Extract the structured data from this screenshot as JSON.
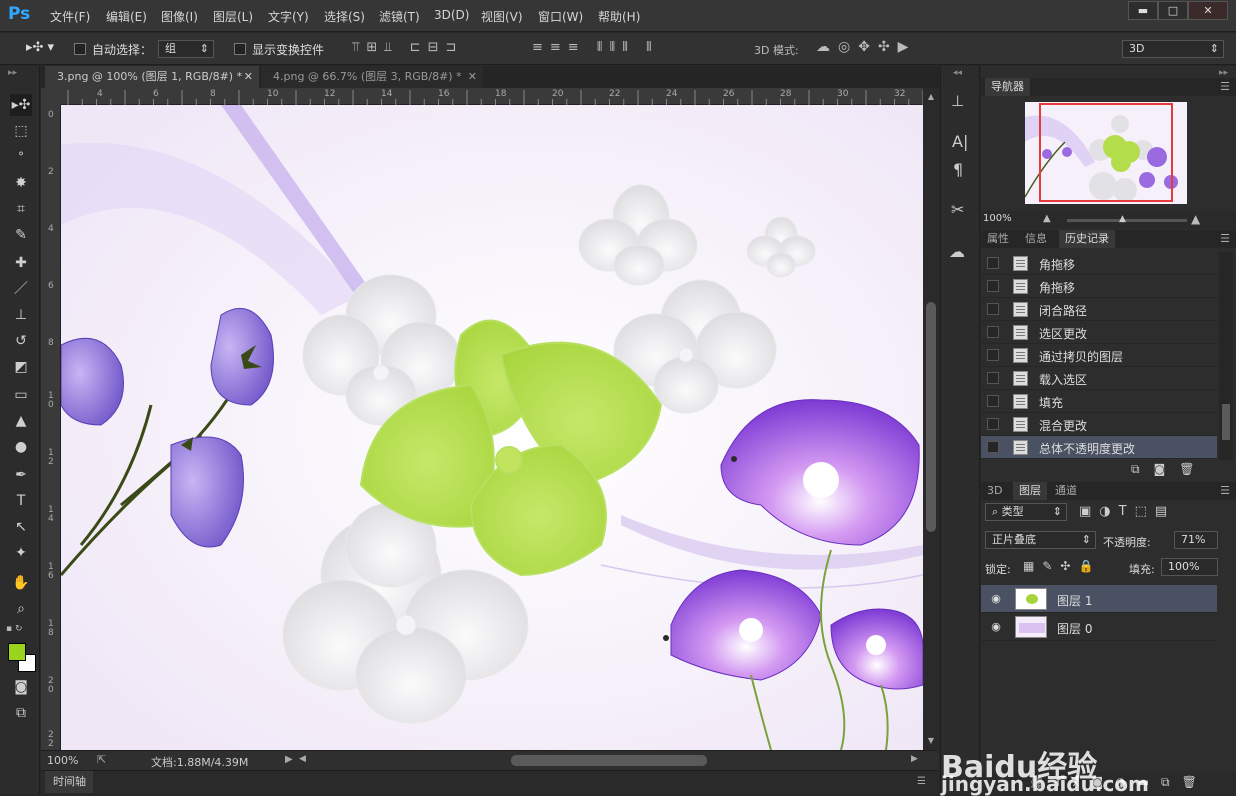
{
  "app": {
    "logo": "Ps"
  },
  "menu": [
    "文件(F)",
    "编辑(E)",
    "图像(I)",
    "图层(L)",
    "文字(Y)",
    "选择(S)",
    "滤镜(T)",
    "3D(D)",
    "视图(V)",
    "窗口(W)",
    "帮助(H)"
  ],
  "window_buttons": [
    "▬",
    "□",
    "✕"
  ],
  "options": {
    "auto_select_label": "自动选择：",
    "auto_select_value": "组",
    "show_transform_label": "显示变换控件",
    "mode3d_label": "3D 模式:",
    "workspace": "3D"
  },
  "tabs": [
    {
      "label": "3.png @ 100% (图层 1, RGB/8#) *",
      "active": true
    },
    {
      "label": "4.png @ 66.7% (图层 3, RGB/8#) *",
      "active": false
    }
  ],
  "ruler_h": [
    "4",
    "6",
    "8",
    "10",
    "12",
    "14",
    "16",
    "18",
    "20",
    "22",
    "24",
    "26",
    "28",
    "30",
    "32"
  ],
  "ruler_v": [
    "0",
    "2",
    "4",
    "6",
    "8",
    "1\n0",
    "1\n2",
    "1\n4",
    "1\n6",
    "1\n8",
    "2\n0",
    "2\n2"
  ],
  "status": {
    "zoom": "100%",
    "doc": "文档:1.88M/4.39M"
  },
  "timeline_label": "时间轴",
  "navigator": {
    "tab": "导航器",
    "zoom": "100%"
  },
  "history_tabs": [
    "属性",
    "信息",
    "历史记录"
  ],
  "history": [
    {
      "label": "角拖移",
      "selected": false
    },
    {
      "label": "角拖移",
      "selected": false
    },
    {
      "label": "闭合路径",
      "selected": false
    },
    {
      "label": "选区更改",
      "selected": false
    },
    {
      "label": "通过拷贝的图层",
      "selected": false
    },
    {
      "label": "载入选区",
      "selected": false
    },
    {
      "label": "填充",
      "selected": false
    },
    {
      "label": "混合更改",
      "selected": false
    },
    {
      "label": "总体不透明度更改",
      "selected": true
    }
  ],
  "layers_tabs": [
    "3D",
    "图层",
    "通道"
  ],
  "layers": {
    "filter": "类型",
    "blend_mode": "正片叠底",
    "opacity_label": "不透明度:",
    "opacity": "71%",
    "lock_label": "锁定:",
    "fill_label": "填充:",
    "fill": "100%",
    "items": [
      {
        "name": "图层 1",
        "selected": true
      },
      {
        "name": "图层 0",
        "selected": false
      }
    ]
  },
  "watermark": {
    "brand": "Baidu经验",
    "url": "jingyan.baidu.com"
  },
  "colors": {
    "foreground": "#9bd41f",
    "background": "#ffffff",
    "accent": "#31a8ff",
    "selection": "#4a5163"
  }
}
